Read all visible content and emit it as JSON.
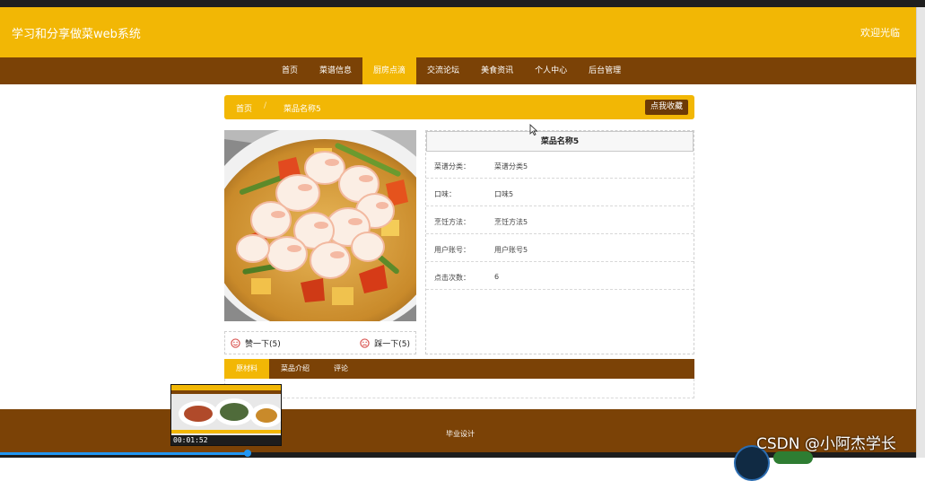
{
  "header": {
    "site_title": "学习和分享做菜web系统",
    "welcome": "欢迎光临"
  },
  "nav": {
    "items": [
      {
        "label": "首页",
        "active": false
      },
      {
        "label": "菜谱信息",
        "active": false
      },
      {
        "label": "厨房点滴",
        "active": true
      },
      {
        "label": "交流论坛",
        "active": false
      },
      {
        "label": "美食资讯",
        "active": false
      },
      {
        "label": "个人中心",
        "active": false
      },
      {
        "label": "后台管理",
        "active": false
      }
    ]
  },
  "breadcrumb": {
    "home": "首页",
    "separator": "/",
    "current": "菜品名称5"
  },
  "actions": {
    "favorite_label": "点我收藏"
  },
  "detail": {
    "title": "菜品名称5",
    "rows": [
      {
        "key": "菜谱分类：",
        "value": "菜谱分类5"
      },
      {
        "key": "口味：",
        "value": "口味5"
      },
      {
        "key": "烹饪方法：",
        "value": "烹饪方法5"
      },
      {
        "key": "用户账号：",
        "value": "用户账号5"
      },
      {
        "key": "点击次数：",
        "value": "6"
      }
    ]
  },
  "votes": {
    "up_label": "赞一下(5)",
    "down_label": "踩一下(5)"
  },
  "tabs": [
    {
      "label": "原材料",
      "active": true
    },
    {
      "label": "菜品介绍",
      "active": false
    },
    {
      "label": "评论",
      "active": false
    }
  ],
  "footer": {
    "text": "毕业设计"
  },
  "player": {
    "thumb_time": "00:01:52",
    "progress": 0.27
  },
  "watermark": "CSDN @小阿杰学长",
  "colors": {
    "accent": "#f2b705",
    "brown": "#7b4206",
    "dark_brown": "#6d3a06",
    "vote_icon": "#d9534f"
  }
}
